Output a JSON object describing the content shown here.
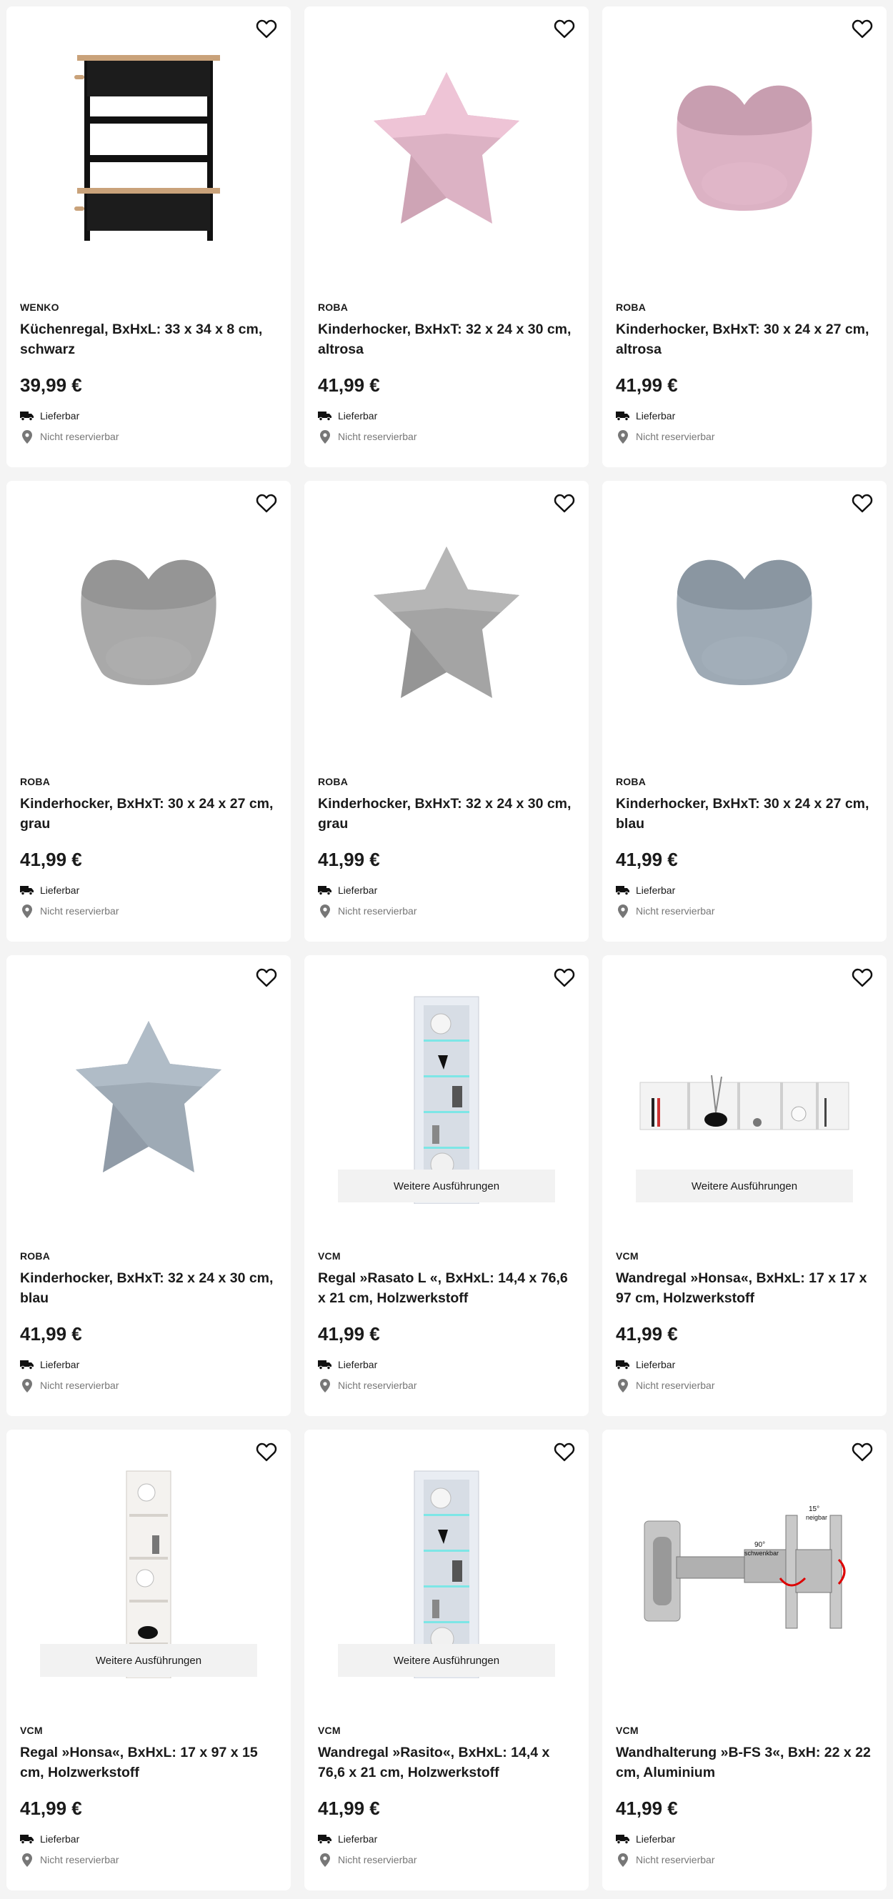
{
  "products": [
    {
      "brand": "WENKO",
      "title": "Küchenregal, BxHxL: 33 x 34 x 8 cm, schwarz",
      "price": "39,99 €",
      "delivery": "Lieferbar",
      "reserve": "Nicht reservierbar",
      "image": "kitchen-rack",
      "variants": null
    },
    {
      "brand": "ROBA",
      "title": "Kinderhocker, BxHxT: 32 x 24 x 30 cm, altrosa",
      "price": "41,99 €",
      "delivery": "Lieferbar",
      "reserve": "Nicht reservierbar",
      "image": "star-stool",
      "color": "#dcb2c4",
      "variants": null
    },
    {
      "brand": "ROBA",
      "title": "Kinderhocker, BxHxT: 30 x 24 x 27 cm, altrosa",
      "price": "41,99 €",
      "delivery": "Lieferbar",
      "reserve": "Nicht reservierbar",
      "image": "heart-stool",
      "color": "#dcb2c4",
      "variants": null
    },
    {
      "brand": "ROBA",
      "title": "Kinderhocker, BxHxT: 30 x 24 x 27 cm, grau",
      "price": "41,99 €",
      "delivery": "Lieferbar",
      "reserve": "Nicht reservierbar",
      "image": "heart-stool",
      "color": "#a9a9a9",
      "variants": null
    },
    {
      "brand": "ROBA",
      "title": "Kinderhocker, BxHxT: 32 x 24 x 30 cm, grau",
      "price": "41,99 €",
      "delivery": "Lieferbar",
      "reserve": "Nicht reservierbar",
      "image": "star-stool",
      "color": "#a4a4a4",
      "variants": null
    },
    {
      "brand": "ROBA",
      "title": "Kinderhocker, BxHxT: 30 x 24 x 27 cm, blau",
      "price": "41,99 €",
      "delivery": "Lieferbar",
      "reserve": "Nicht reservierbar",
      "image": "heart-stool",
      "color": "#9eaab5",
      "variants": null
    },
    {
      "brand": "ROBA",
      "title": "Kinderhocker, BxHxT: 32 x 24 x 30 cm, blau",
      "price": "41,99 €",
      "delivery": "Lieferbar",
      "reserve": "Nicht reservierbar",
      "image": "star-stool",
      "color": "#9eaab5",
      "variants": null
    },
    {
      "brand": "VCM",
      "title": "Regal »Rasato L «, BxHxL: 14,4 x 76,6 x 21 cm, Holzwerkstoff",
      "price": "41,99 €",
      "delivery": "Lieferbar",
      "reserve": "Nicht reservierbar",
      "image": "glass-cabinet",
      "variants": "Weitere Ausführungen"
    },
    {
      "brand": "VCM",
      "title": "Wandregal »Honsa«, BxHxL: 17 x 17 x 97 cm, Holzwerkstoff",
      "price": "41,99 €",
      "delivery": "Lieferbar",
      "reserve": "Nicht reservierbar",
      "image": "wall-shelf",
      "variants": "Weitere Ausführungen"
    },
    {
      "brand": "VCM",
      "title": "Regal »Honsa«, BxHxL: 17 x 97 x 15 cm, Holzwerkstoff",
      "price": "41,99 €",
      "delivery": "Lieferbar",
      "reserve": "Nicht reservierbar",
      "image": "tall-shelf",
      "variants": "Weitere Ausführungen"
    },
    {
      "brand": "VCM",
      "title": "Wandregal »Rasito«, BxHxL: 14,4 x 76,6 x 21 cm, Holzwerkstoff",
      "price": "41,99 €",
      "delivery": "Lieferbar",
      "reserve": "Nicht reservierbar",
      "image": "glass-cabinet",
      "variants": "Weitere Ausführungen"
    },
    {
      "brand": "VCM",
      "title": "Wandhalterung »B-FS 3«, BxH: 22 x 22 cm, Aluminium",
      "price": "41,99 €",
      "delivery": "Lieferbar",
      "reserve": "Nicht reservierbar",
      "image": "tv-wall-mount",
      "variants": null,
      "image_labels": [
        "15°",
        "neigbar",
        "90°",
        "schwenkbar"
      ]
    }
  ],
  "icons": {
    "favorite": "heart-outline-icon",
    "delivery": "truck-icon",
    "reserve": "location-pin-icon"
  }
}
